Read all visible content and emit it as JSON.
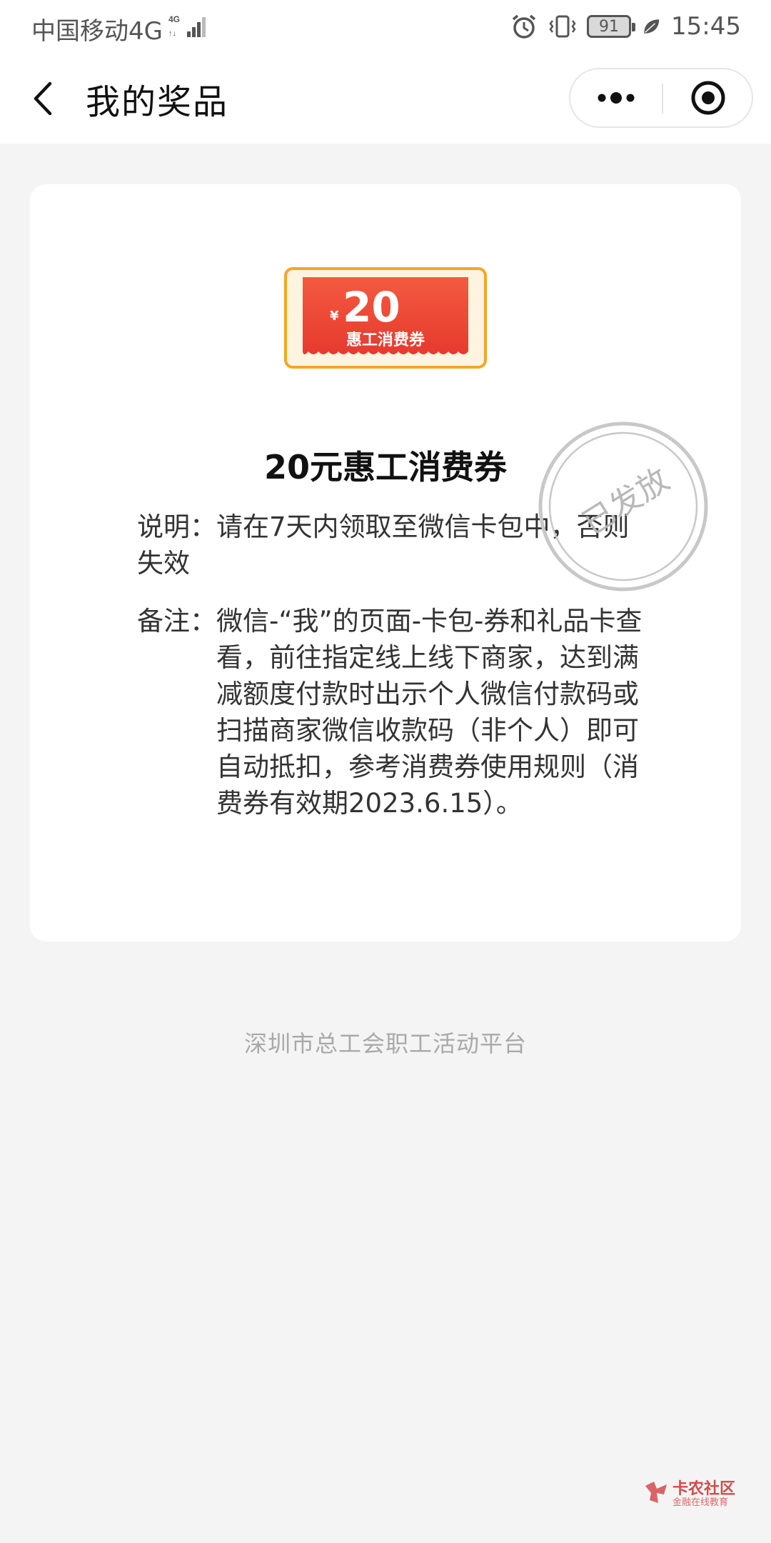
{
  "status_bar": {
    "carrier": "中国移动4G",
    "battery": "91",
    "time": "15:45"
  },
  "nav": {
    "title": "我的奖品"
  },
  "prize": {
    "voucher_amount": "20",
    "voucher_currency": "¥",
    "voucher_label": "惠工消费券",
    "title": "20元惠工消费券",
    "desc_label": "说明：",
    "desc_text": "请在7天内领取至微信卡包中，否则失效",
    "note_label": "备注：",
    "note_text": "微信-“我”的页面-卡包-券和礼品卡查看，前往指定线上线下商家，达到满减额度付款时出示个人微信付款码或扫描商家微信收款码（非个人）即可自动抵扣，参考消费券使用规则（消费券有效期2023.6.15）。",
    "stamp_text": "已发放"
  },
  "footer": {
    "text": "深圳市总工会职工活动平台"
  },
  "watermark": {
    "main": "卡农社区",
    "sub": "金融在线教育"
  },
  "colors": {
    "voucher_red": "#ec4a3c",
    "voucher_border": "#f5a623",
    "stamp_gray": "#c8c8c8",
    "page_bg": "#f4f4f4"
  }
}
